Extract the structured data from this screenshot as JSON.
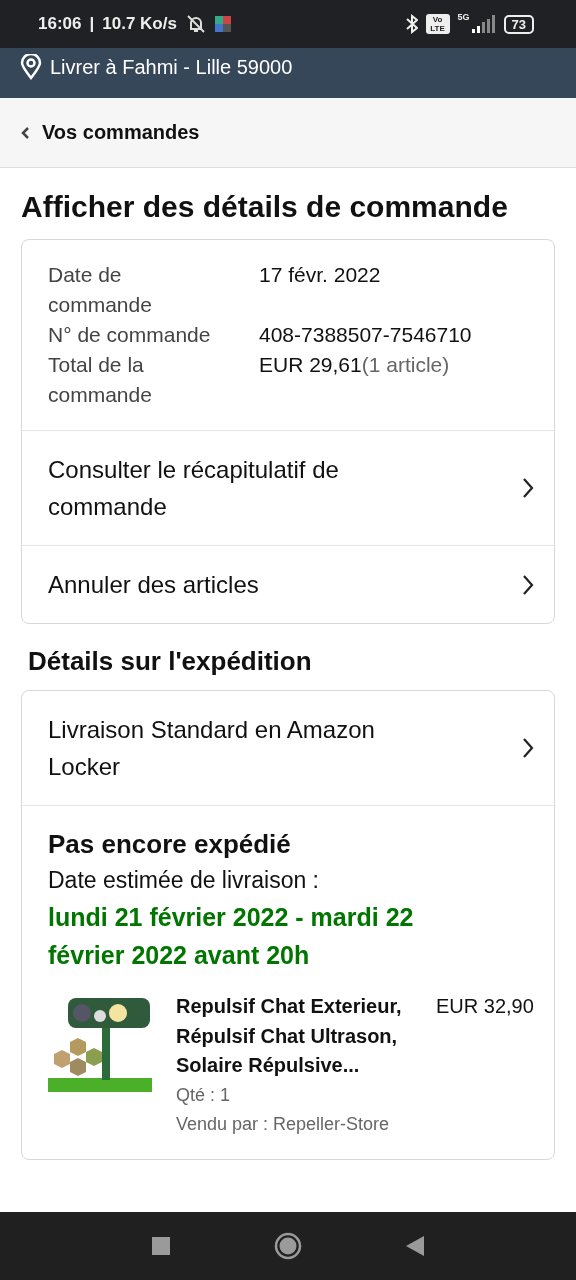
{
  "status_bar": {
    "time": "16:06",
    "separator": "|",
    "speed": "10.7 Ko/s",
    "network": "5G",
    "volte": "Vo LTE",
    "battery": "73"
  },
  "location": {
    "text": "Livrer à Fahmi - Lille 59000"
  },
  "nav": {
    "back_label": "Vos commandes"
  },
  "title": "Afficher des détails de commande",
  "order_info": [
    {
      "label": "Date de commande",
      "value": "17 févr. 2022"
    },
    {
      "label": "N° de commande",
      "value": "408-7388507-7546710"
    },
    {
      "label": "Total de la commande",
      "value": "EUR 29,61",
      "note": "(1 article)"
    }
  ],
  "order_links": [
    "Consulter le récapitulatif de commande",
    "Annuler des articles"
  ],
  "shipping": {
    "heading": "Détails sur l'expédition",
    "method": "Livraison Standard en Amazon Locker",
    "status": "Pas encore expédié",
    "estimate_label": "Date estimée de livraison :",
    "estimate": "lundi 21 février 2022 - mardi 22 février 2022 avant 20h",
    "item": {
      "title": "Repulsif Chat Exterieur, Répulsif Chat Ultrason, Solaire Répulsive...",
      "price": "EUR 32,90",
      "qty": "Qté : 1",
      "seller": "Vendu par : Repeller-Store"
    }
  }
}
